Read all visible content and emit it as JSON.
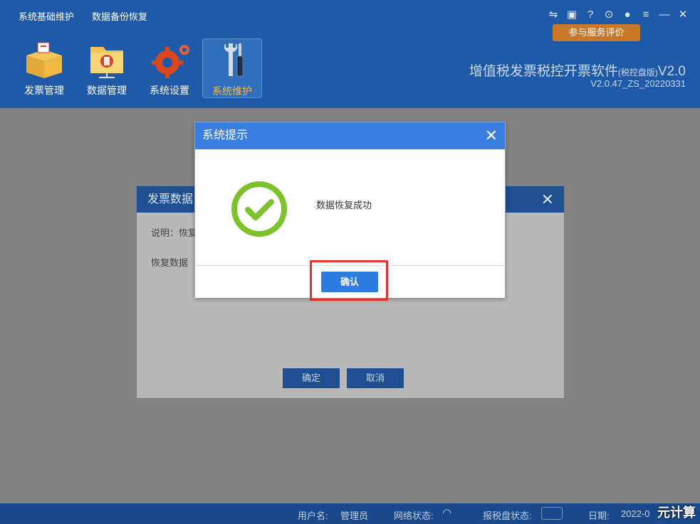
{
  "menu": {
    "item1": "系统基础维护",
    "item2": "数据备份恢复"
  },
  "rating_button": "参与服务评价",
  "window_icons": [
    "switch-icon",
    "feedback-icon",
    "help-icon",
    "lock-icon",
    "user-icon",
    "menu-icon",
    "minimize-icon",
    "close-icon"
  ],
  "nav": [
    {
      "label": "发票管理",
      "icon": "invoice-box-icon"
    },
    {
      "label": "数据管理",
      "icon": "data-folder-icon"
    },
    {
      "label": "系统设置",
      "icon": "gear-icon"
    },
    {
      "label": "系统维护",
      "icon": "tools-icon",
      "active": true
    }
  ],
  "app": {
    "title": "增值税发票税控开票软件",
    "edition": "(税控盘版)",
    "title_suffix": "V2.0",
    "version": "V2.0.47_ZS_20220331"
  },
  "bg_dialog": {
    "title": "发票数据",
    "line1": "说明：恢复",
    "line2": "恢复数据",
    "ok": "确定",
    "cancel": "取消"
  },
  "dialog": {
    "title": "系统提示",
    "message": "数据恢复成功",
    "confirm": "确认"
  },
  "status": {
    "user_label": "用户名:",
    "user_value": "管理员",
    "network_label": "网络状态:",
    "disk_label": "报税盘状态:",
    "date_label": "日期:",
    "date_value": "2022-0"
  },
  "watermark": "元计算",
  "colors": {
    "header": "#1e5aa8",
    "accent": "#2e7ce0",
    "success": "#7cc32b",
    "highlight": "#e4322b"
  }
}
